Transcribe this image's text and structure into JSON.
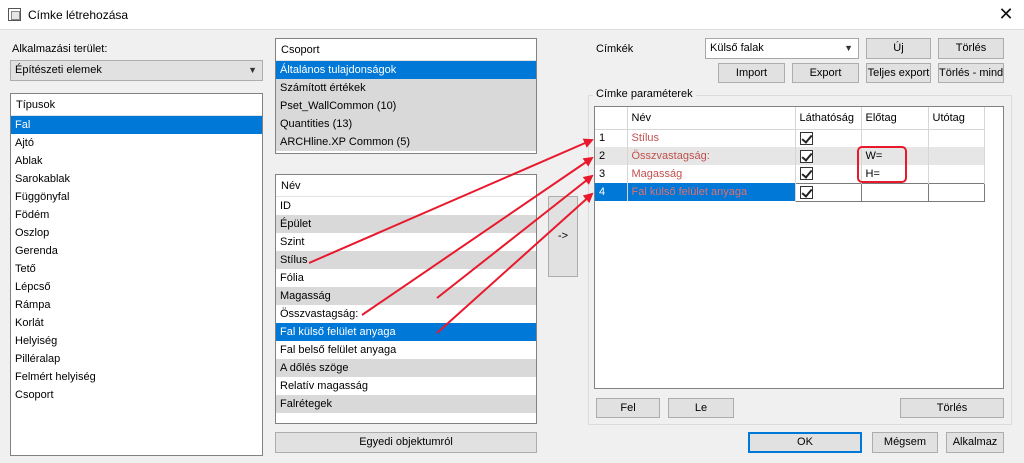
{
  "window": {
    "title": "Címke létrehozása",
    "close": "✕"
  },
  "application_area": {
    "label": "Alkalmazási terület:",
    "selected": "Építészeti elemek"
  },
  "types": {
    "header": "Típusok",
    "items": [
      "Fal",
      "Ajtó",
      "Ablak",
      "Sarokablak",
      "Függönyfal",
      "Födém",
      "Oszlop",
      "Gerenda",
      "Tető",
      "Lépcső",
      "Rámpa",
      "Korlát",
      "Helyiség",
      "Pilléralap",
      "Felmért helyiség",
      "Csoport"
    ],
    "selected_index": 0
  },
  "groups": {
    "header": "Csoport",
    "items": [
      "Általános tulajdonságok",
      "Számított értékek",
      "Pset_WallCommon (10)",
      "Quantities (13)",
      "ARCHline.XP Common (5)"
    ]
  },
  "names": {
    "header": "Név",
    "items": [
      "ID",
      "Épület",
      "Szint",
      "Stílus",
      "Fólia",
      "Magasság",
      "Összvastagság:",
      "Fal külső felület anyaga",
      "Fal belső felület anyaga",
      "A dőlés szöge",
      "Relatív magasság",
      "Falrétegek"
    ],
    "selected_index": 7
  },
  "buttons": {
    "from_object": "Egyedi objektumról",
    "transfer": "->",
    "new": "Új",
    "delete": "Törlés",
    "import": "Import",
    "export": "Export",
    "full_export": "Teljes export",
    "delete_all": "Törlés - mind",
    "up": "Fel",
    "down": "Le",
    "delete_param": "Törlés",
    "ok": "OK",
    "cancel": "Mégsem",
    "apply": "Alkalmaz"
  },
  "labels_section": {
    "label": "Címkék",
    "selected": "Külső falak"
  },
  "params": {
    "title": "Címke paraméterek",
    "columns": [
      "",
      "Név",
      "Láthatóság",
      "Előtag",
      "Utótag"
    ],
    "rows": [
      {
        "num": "1",
        "name": "Stílus",
        "visible": true,
        "prefix": "",
        "suffix": ""
      },
      {
        "num": "2",
        "name": "Összvastagság:",
        "visible": true,
        "prefix": "W=",
        "suffix": ""
      },
      {
        "num": "3",
        "name": "Magasság",
        "visible": true,
        "prefix": "H=",
        "suffix": ""
      },
      {
        "num": "4",
        "name": "Fal külső felület anyaga",
        "visible": true,
        "prefix": "",
        "suffix": ""
      }
    ]
  },
  "colors": {
    "selection": "#0078d7",
    "annotation": "#e8192c",
    "param_text": "#c0504d"
  }
}
